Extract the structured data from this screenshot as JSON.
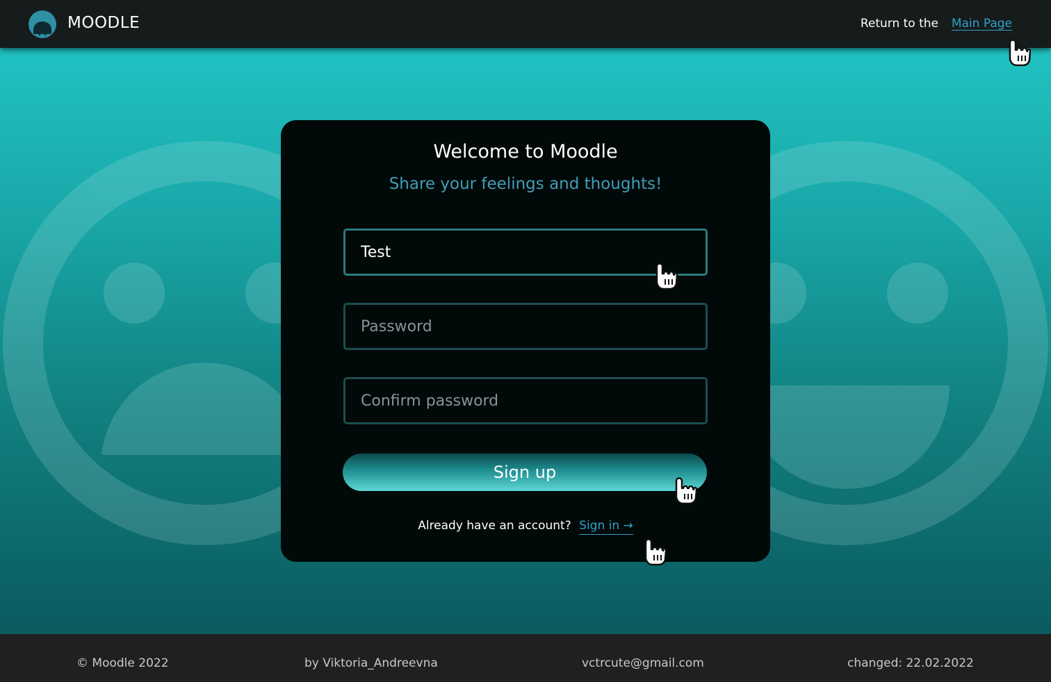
{
  "header": {
    "brand": "MOODLE",
    "logo_letter": "M",
    "return_text": "Return to the",
    "main_page_link": "Main Page"
  },
  "card": {
    "title": "Welcome to Moodle",
    "subtitle": "Share your feelings and thoughts!",
    "fields": {
      "username": {
        "value": "Test",
        "placeholder": ""
      },
      "password": {
        "value": "",
        "placeholder": "Password"
      },
      "confirm": {
        "value": "",
        "placeholder": "Confirm password"
      }
    },
    "signup_label": "Sign up",
    "account_question": "Already have an account?",
    "signin_label": "Sign in",
    "signin_arrow": "→"
  },
  "footer": {
    "copyright": "© Moodle 2022",
    "author": "by Viktoria_Andreevna",
    "email": "vctrcute@gmail.com",
    "changed": "changed: 22.02.2022"
  },
  "icons": {
    "logo": "moodle-logo-icon",
    "cursor": "hand-pointer-icon",
    "background": [
      "sad-face-icon",
      "happy-face-icon"
    ]
  },
  "colors": {
    "header_bg": "#161b1c",
    "accent_link": "#2fa3c9",
    "subtitle": "#3e9fb6",
    "card_bg": "#020909",
    "field_border": "#1b4e50",
    "footer_bg": "#202020",
    "gradient_top": "#21c2c2",
    "gradient_bottom": "#0a5a5e"
  }
}
